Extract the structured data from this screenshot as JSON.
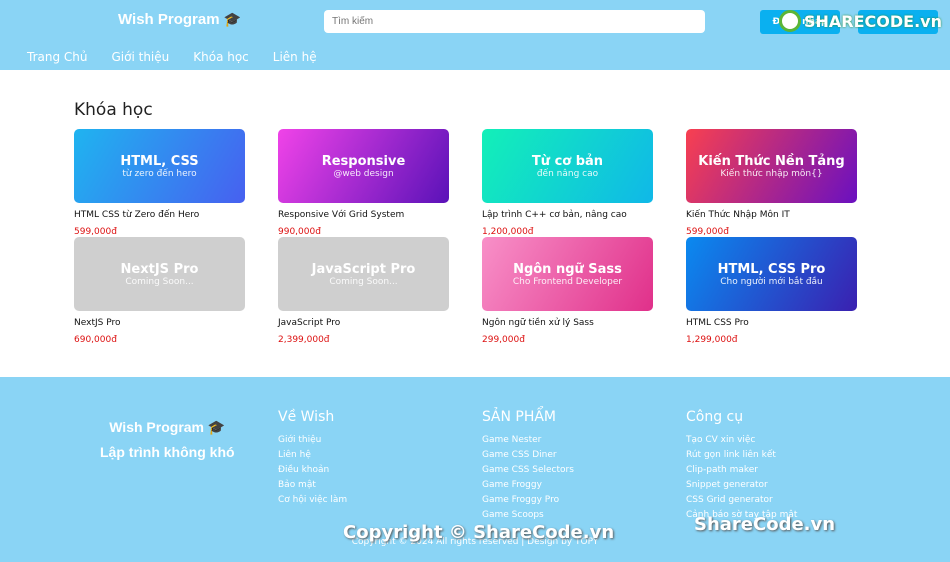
{
  "header": {
    "logo": "Wish Program",
    "search_placeholder": "Tìm kiếm",
    "login_label": "Đăng nhập",
    "register_label": "",
    "watermark": "SHARECODE.vn",
    "nav": [
      "Trang Chủ",
      "Giới thiệu",
      "Khóa học",
      "Liên hệ"
    ]
  },
  "main": {
    "title": "Khóa học",
    "courses": [
      {
        "t1": "HTML, CSS",
        "t2": "từ zero đến hero",
        "name": "HTML CSS từ Zero đến Hero",
        "price": "599,000đ",
        "bg": "linear-gradient(120deg,#1fb4f0,#4760f0)"
      },
      {
        "t1": "Responsive",
        "t2": "@web design",
        "name": "Responsive Với Grid System",
        "price": "990,000đ",
        "bg": "linear-gradient(120deg,#f043e8,#5a12b8)"
      },
      {
        "t1": "Từ cơ bản",
        "t2": "đến nâng cao",
        "name": "Lập trình C++ cơ bản, nâng cao",
        "price": "1,200,000đ",
        "bg": "linear-gradient(120deg,#12f0b8,#10b8e8)"
      },
      {
        "t1": "Kiến Thức Nền Tảng",
        "t2": "Kiến thức nhập môn{}",
        "name": "Kiến Thức Nhập Môn IT",
        "price": "599,000đ",
        "bg": "linear-gradient(120deg,#f84050,#6a10c0)"
      },
      {
        "t1": "NextJS Pro",
        "t2": "Coming Soon...",
        "name": "NextJS Pro",
        "price": "690,000đ",
        "bg": "#cfcfcf"
      },
      {
        "t1": "JavaScript Pro",
        "t2": "Coming Soon...",
        "name": "JavaScript Pro",
        "price": "2,399,000đ",
        "bg": "#cfcfcf"
      },
      {
        "t1": "Ngôn ngữ Sass",
        "t2": "Cho Frontend Developer",
        "name": "Ngôn ngữ tiền xử lý Sass",
        "price": "299,000đ",
        "bg": "linear-gradient(120deg,#f890c8,#e0308a)"
      },
      {
        "t1": "HTML, CSS Pro",
        "t2": "Cho người mới bắt đầu",
        "name": "HTML CSS Pro",
        "price": "1,299,000đ",
        "bg": "linear-gradient(120deg,#0a8af0,#3a20b0)"
      }
    ]
  },
  "footer": {
    "logo": "Wish Program",
    "slogan": "Lập trình không khó",
    "cols": [
      {
        "title": "Về Wish",
        "links": [
          "Giới thiệu",
          "Liên hệ",
          "Điều khoản",
          "Bảo mật",
          "Cơ hội việc làm"
        ]
      },
      {
        "title": "SẢN PHẨM",
        "links": [
          "Game Nester",
          "Game CSS Diner",
          "Game CSS Selectors",
          "Game Froggy",
          "Game Froggy Pro",
          "Game Scoops"
        ]
      },
      {
        "title": "Công cụ",
        "links": [
          "Tạo CV xin việc",
          "Rút gọn link liên kết",
          "Clip-path maker",
          "Snippet generator",
          "CSS Grid generator",
          "Cảnh báo sờ tay tập mật"
        ]
      }
    ],
    "copyright": "Copyright © 2024 All rights reserved | Design by TOPY",
    "watermark1": "Copyright © ShareCode.vn",
    "watermark2": "ShareCode.vn"
  }
}
